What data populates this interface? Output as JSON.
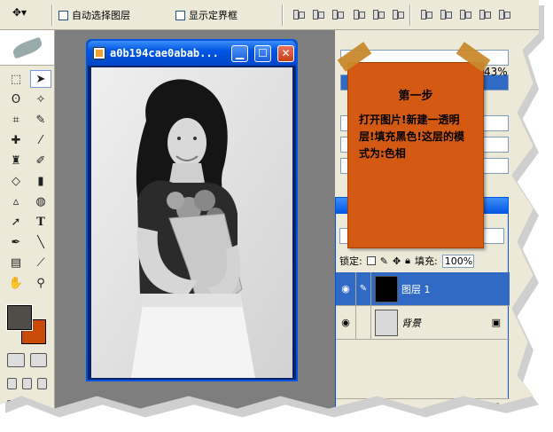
{
  "options_bar": {
    "auto_select_label": "自动选择图层",
    "show_bounds_label": "显示定界框"
  },
  "document": {
    "title": "a0b194cae0abab..."
  },
  "palettes": {
    "zoom_pct": "43%"
  },
  "layers": {
    "lock_label": "锁定:",
    "fill_label": "填充:",
    "fill_value": "100%",
    "items": [
      {
        "name": "图层 1",
        "selected": true
      },
      {
        "name": "背景",
        "selected": false
      }
    ]
  },
  "note": {
    "title": "第一步",
    "body": "打开图片!新建一透明层!填充黑色!这层的模式为:色相"
  },
  "colors": {
    "foreground": "#504c48",
    "background": "#c94a09",
    "note_bg": "#d45a14"
  },
  "icons": [
    "move-icon",
    "marquee-icon",
    "lasso-icon",
    "magic-wand-icon",
    "crop-icon",
    "slice-icon",
    "healing-icon",
    "brush-icon",
    "stamp-icon",
    "history-brush-icon",
    "eraser-icon",
    "gradient-icon",
    "blur-icon",
    "dodge-icon",
    "path-select-icon",
    "type-icon",
    "pen-icon",
    "line-icon",
    "notes-icon",
    "eyedropper-icon",
    "hand-icon",
    "zoom-icon",
    "eye-icon",
    "lock-icon"
  ]
}
